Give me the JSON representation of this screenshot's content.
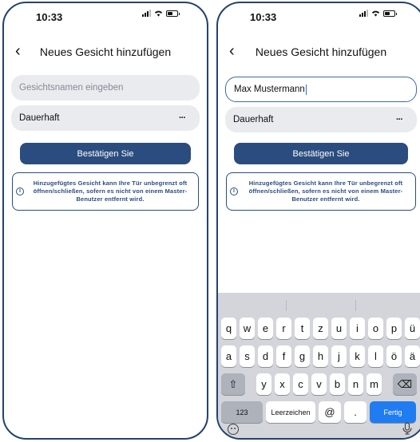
{
  "status": {
    "time": "10:33"
  },
  "nav": {
    "back": "‹",
    "title": "Neues Gesicht hinzufügen"
  },
  "left": {
    "name_placeholder": "Gesichtsnamen eingeben",
    "duration": "Dauerhaft",
    "more": "···",
    "confirm": "Bestätigen Sie",
    "info": "Hinzugefügtes Gesicht kann Ihre Tür unbegrenzt oft öffnen/schließen, sofern es nicht von einem Master-Benutzer entfernt wird."
  },
  "right": {
    "name_value": "Max Mustermann",
    "duration": "Dauerhaft",
    "more": "···",
    "confirm": "Bestätigen Sie",
    "info": "Hinzugefügtes Gesicht kann Ihre Tür unbegrenzt oft öffnen/schließen, sofern es nicht von einem Master-Benutzer entfernt wird."
  },
  "keyboard": {
    "row1": [
      "q",
      "w",
      "e",
      "r",
      "t",
      "z",
      "u",
      "i",
      "o",
      "p",
      "ü"
    ],
    "row2": [
      "a",
      "s",
      "d",
      "f",
      "g",
      "h",
      "j",
      "k",
      "l",
      "ö",
      "ä"
    ],
    "row3": [
      "y",
      "x",
      "c",
      "v",
      "b",
      "n",
      "m"
    ],
    "shift": "⇧",
    "delete": "⌫",
    "numbers": "123",
    "space": "Leerzeichen",
    "at": "@",
    "dot": ".",
    "done": "Fertig"
  },
  "colors": {
    "primary": "#2b4c7e",
    "accent": "#1f7cf1",
    "field": "#e9ebef"
  }
}
